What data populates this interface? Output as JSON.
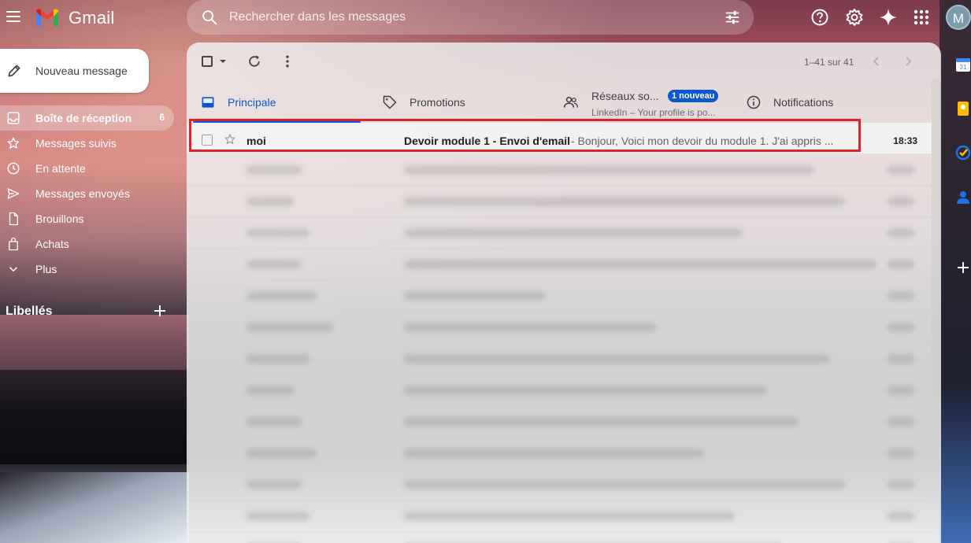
{
  "app": {
    "name": "Gmail"
  },
  "search": {
    "placeholder": "Rechercher dans les messages"
  },
  "avatar": {
    "initial": "M"
  },
  "compose": {
    "label": "Nouveau message"
  },
  "sidebar": {
    "items": [
      {
        "label": "Boîte de réception",
        "count": "6",
        "icon": "inbox-icon"
      },
      {
        "label": "Messages suivis",
        "icon": "star-icon"
      },
      {
        "label": "En attente",
        "icon": "clock-icon"
      },
      {
        "label": "Messages envoyés",
        "icon": "send-icon"
      },
      {
        "label": "Brouillons",
        "icon": "draft-icon"
      },
      {
        "label": "Achats",
        "icon": "shopping-bag-icon"
      },
      {
        "label": "Plus",
        "icon": "chevron-down-icon"
      }
    ],
    "labels_title": "Libellés"
  },
  "toolbar": {
    "pager": "1–41 sur 41"
  },
  "tabs": [
    {
      "label": "Principale",
      "icon": "inbox-tab-icon"
    },
    {
      "label": "Promotions",
      "icon": "tag-icon"
    },
    {
      "label": "Réseaux so...",
      "badge": "1 nouveau",
      "sub": "LinkedIn – Your profile is po...",
      "icon": "people-icon"
    },
    {
      "label": "Notifications",
      "icon": "info-icon"
    }
  ],
  "emails": [
    {
      "sender": "moi",
      "subject": "Devoir module 1 - Envoi d'email",
      "snippet": " - Bonjour, Voici mon devoir du module 1. J'ai appris ...",
      "time": "18:33"
    }
  ],
  "colors": {
    "accent": "#0b57d0",
    "highlight_border": "#e0212a"
  }
}
